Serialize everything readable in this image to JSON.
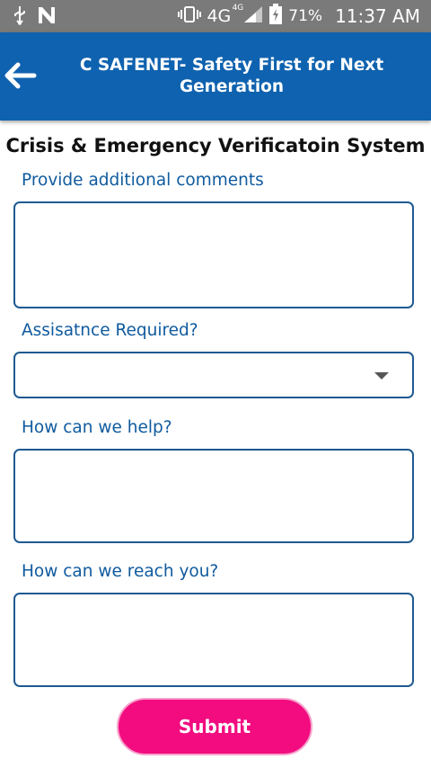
{
  "status_bar": {
    "network": "4G",
    "network_sup": "4G",
    "battery": "71%",
    "time": "11:37 AM"
  },
  "app_bar": {
    "title": "C SAFENET- Safety First for Next Generation"
  },
  "form": {
    "heading": "Crisis & Emergency Verificatoin System",
    "comments_label": "Provide additional comments",
    "comments_value": "",
    "assistance_label": "Assisatnce Required?",
    "assistance_value": "",
    "help_label": "How can we help?",
    "help_value": "",
    "reach_label": "How can we reach you?",
    "reach_value": "",
    "submit_label": "Submit"
  },
  "colors": {
    "app_bar": "#0f62af",
    "label": "#0f5a9e",
    "submit": "#f20c80",
    "status_bar": "#7a7a7a"
  }
}
